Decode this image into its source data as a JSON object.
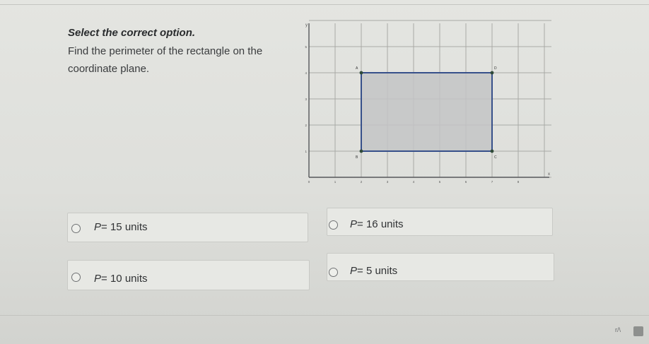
{
  "instruction": "Select the correct option.",
  "question": "Find the perimeter of the rectangle on the coordinate plane.",
  "graph": {
    "axis_x_label": "x",
    "axis_y_label": "y",
    "x_ticks": [
      "0",
      "1",
      "2",
      "3",
      "4",
      "5",
      "6",
      "7",
      "8"
    ],
    "y_ticks": [
      "1",
      "2",
      "3",
      "4",
      "5"
    ],
    "points": [
      {
        "label": "A",
        "x": 2,
        "y": 4
      },
      {
        "label": "D",
        "x": 7,
        "y": 4
      },
      {
        "label": "C",
        "x": 7,
        "y": 1
      },
      {
        "label": "B",
        "x": 2,
        "y": 1
      }
    ],
    "rect_fill": "#c3c4c6",
    "rect_stroke": "#37508a"
  },
  "options": [
    {
      "var": "P",
      "eq": "= 15",
      "unit": "units"
    },
    {
      "var": "P",
      "eq": "= 16",
      "unit": "units"
    },
    {
      "var": "P",
      "eq": "= 10",
      "unit": "units"
    },
    {
      "var": "P",
      "eq": "= 5",
      "unit": "units"
    }
  ],
  "corner": {
    "text": "r/\\"
  }
}
